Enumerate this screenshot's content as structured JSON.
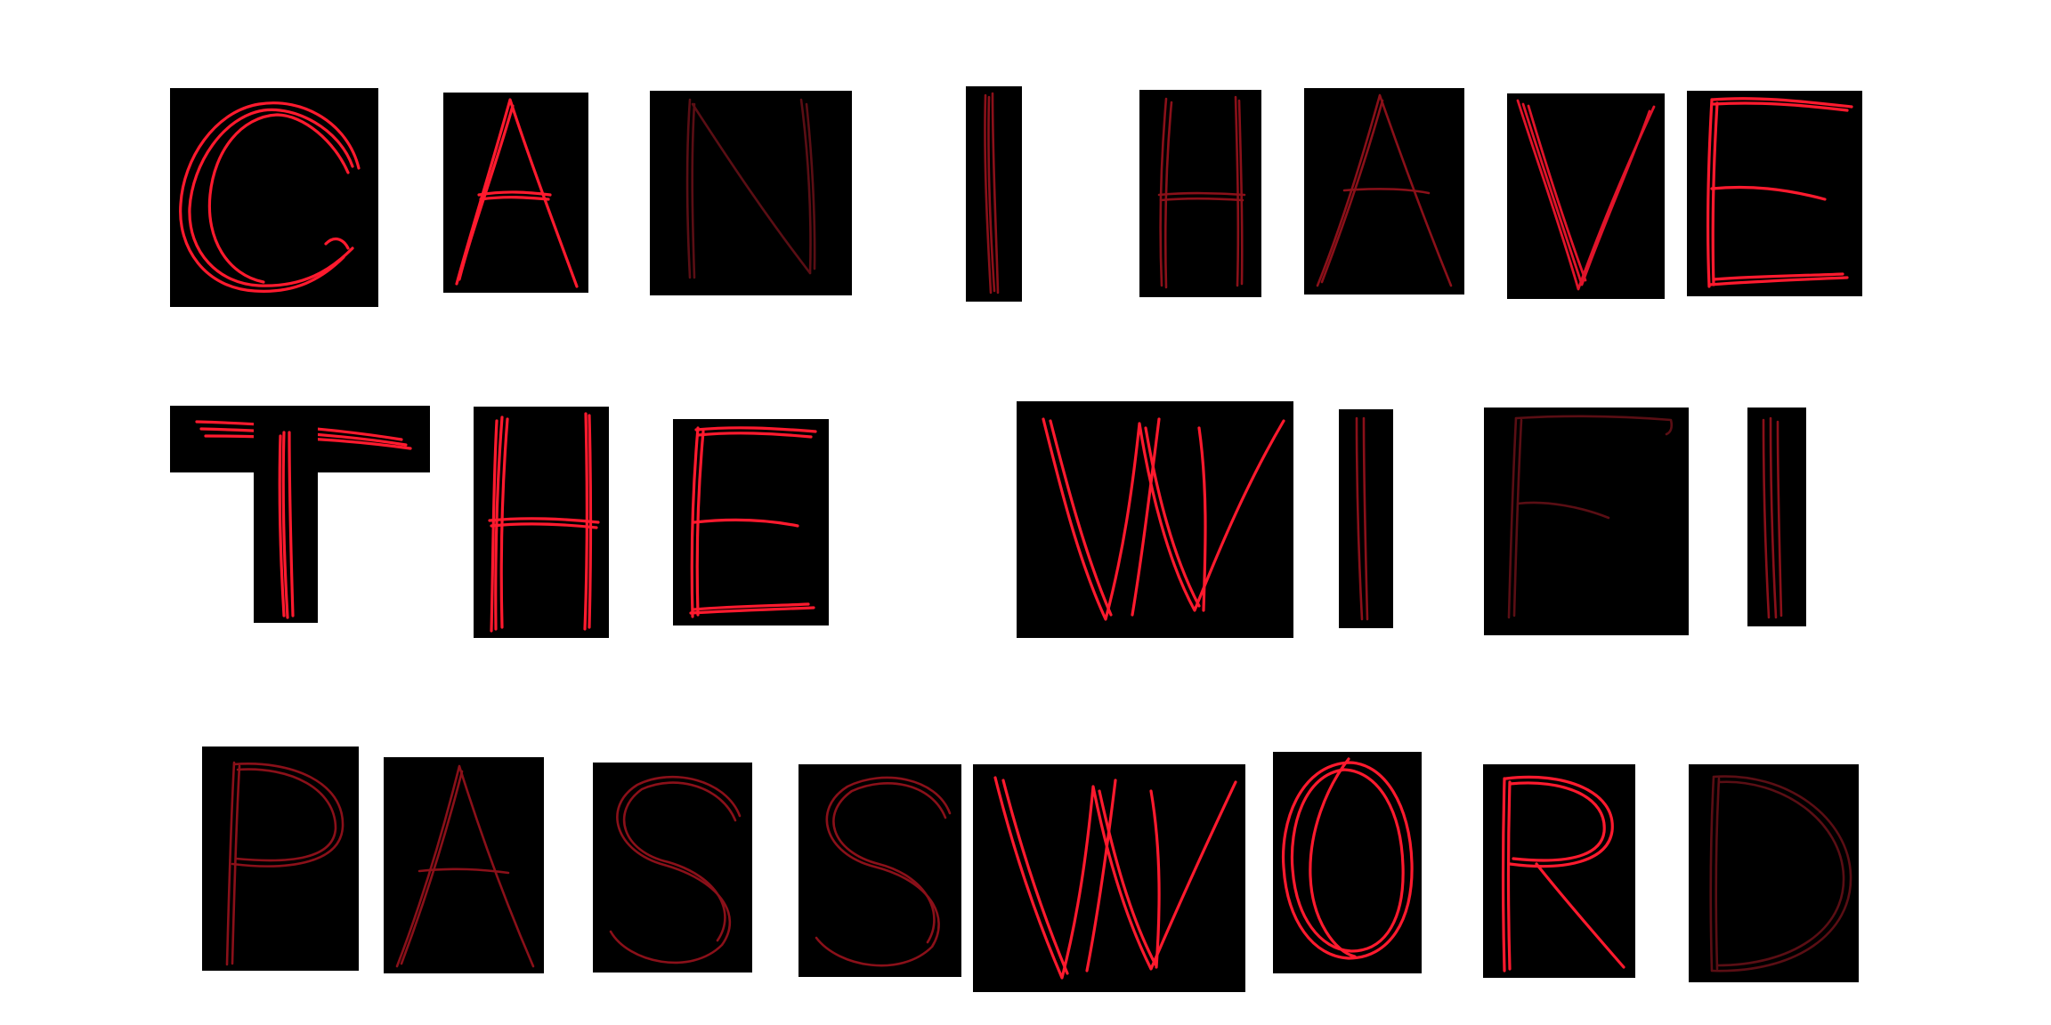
{
  "message": {
    "lines": [
      {
        "letters": [
          "C",
          "A",
          "N",
          "I",
          "H",
          "A",
          "V",
          "E"
        ]
      },
      {
        "letters": [
          "T",
          "H",
          "E",
          "W",
          "I",
          "F",
          "I"
        ]
      },
      {
        "letters": [
          "P",
          "A",
          "S",
          "S",
          "W",
          "O",
          "R",
          "D"
        ]
      }
    ],
    "full_text": "CAN I HAVE THE WIFI PASSWORD"
  },
  "colors": {
    "background": "#ffffff",
    "tile": "#000000",
    "stroke_bright": "#ff1a2e",
    "stroke_dark": "#5a0e14"
  },
  "style": "hand-drawn red letters on black tiles"
}
